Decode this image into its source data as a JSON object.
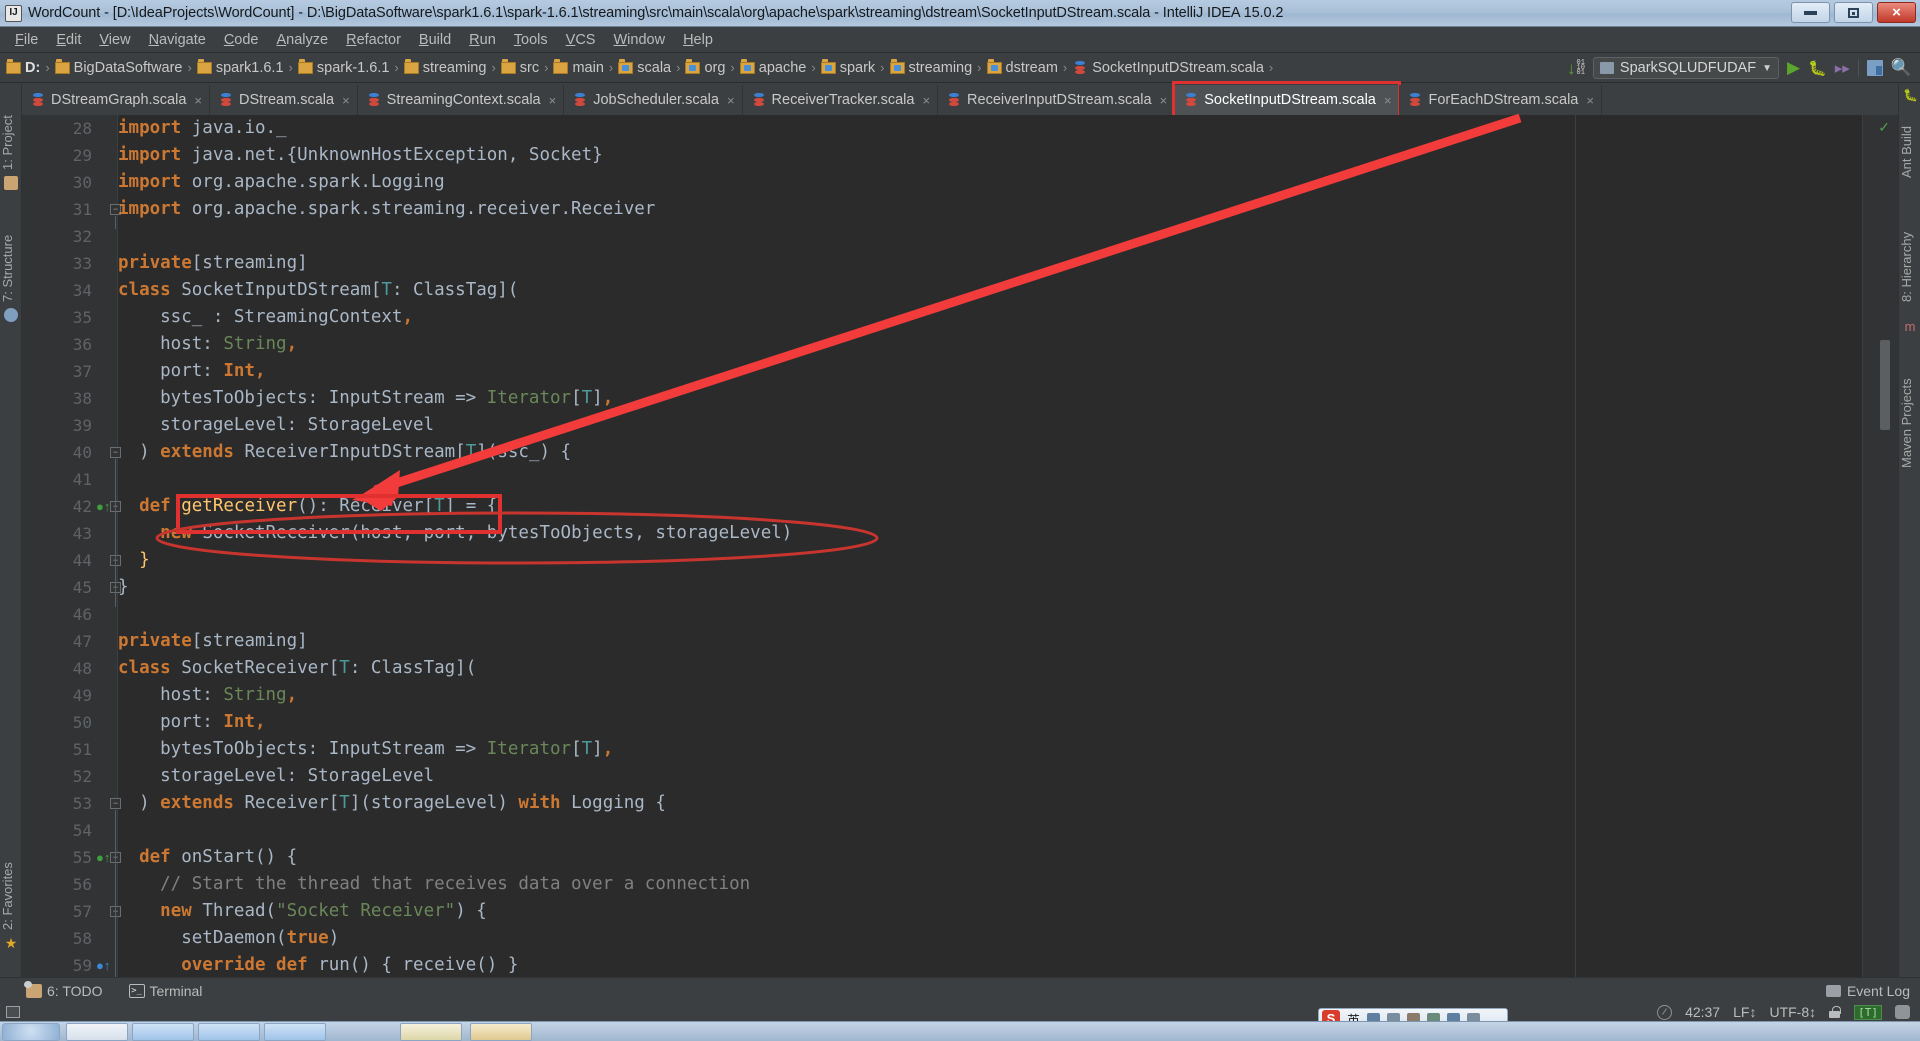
{
  "window": {
    "title": "WordCount - [D:\\IdeaProjects\\WordCount] - D:\\BigDataSoftware\\spark1.6.1\\spark-1.6.1\\streaming\\src\\main\\scala\\org\\apache\\spark\\streaming\\dstream\\SocketInputDStream.scala - IntelliJ IDEA 15.0.2",
    "app_icon": "intellij-idea-icon",
    "minimize": "minimize-button",
    "maximize": "maximize-button",
    "close": "close-button"
  },
  "menubar": {
    "items": [
      {
        "label": "File"
      },
      {
        "label": "Edit"
      },
      {
        "label": "View"
      },
      {
        "label": "Navigate"
      },
      {
        "label": "Code"
      },
      {
        "label": "Analyze"
      },
      {
        "label": "Refactor"
      },
      {
        "label": "Build"
      },
      {
        "label": "Run"
      },
      {
        "label": "Tools"
      },
      {
        "label": "VCS"
      },
      {
        "label": "Window"
      },
      {
        "label": "Help"
      }
    ]
  },
  "navbar": {
    "crumbs": [
      {
        "label": "D:",
        "icon": "folder-icon",
        "bold": true
      },
      {
        "label": "BigDataSoftware",
        "icon": "folder-icon"
      },
      {
        "label": "spark1.6.1",
        "icon": "folder-icon"
      },
      {
        "label": "spark-1.6.1",
        "icon": "folder-icon"
      },
      {
        "label": "streaming",
        "icon": "folder-icon"
      },
      {
        "label": "src",
        "icon": "folder-icon"
      },
      {
        "label": "main",
        "icon": "folder-icon"
      },
      {
        "label": "scala",
        "icon": "source-folder-icon"
      },
      {
        "label": "org",
        "icon": "package-folder-icon"
      },
      {
        "label": "apache",
        "icon": "package-folder-icon"
      },
      {
        "label": "spark",
        "icon": "package-folder-icon"
      },
      {
        "label": "streaming",
        "icon": "package-folder-icon"
      },
      {
        "label": "dstream",
        "icon": "package-folder-icon"
      },
      {
        "label": "SocketInputDStream.scala",
        "icon": "scala-file-icon"
      }
    ],
    "separator": "›",
    "run_config": "SparkSQLUDFUDAF",
    "actions": [
      {
        "name": "update-project-icon"
      },
      {
        "name": "run-button"
      },
      {
        "name": "debug-button"
      },
      {
        "name": "run-with-coverage-button"
      },
      {
        "name": "project-structure-button"
      },
      {
        "name": "search-everywhere-button"
      }
    ]
  },
  "tabs": {
    "items": [
      {
        "label": "DStreamGraph.scala",
        "active": false
      },
      {
        "label": "DStream.scala",
        "active": false
      },
      {
        "label": "StreamingContext.scala",
        "active": false
      },
      {
        "label": "JobScheduler.scala",
        "active": false
      },
      {
        "label": "ReceiverTracker.scala",
        "active": false
      },
      {
        "label": "ReceiverInputDStream.scala",
        "active": false
      },
      {
        "label": "SocketInputDStream.scala",
        "active": true
      },
      {
        "label": "ForEachDStream.scala",
        "active": false
      }
    ],
    "close_glyph": "×",
    "file_icon": "scala-file-icon"
  },
  "left_strip": {
    "items": [
      {
        "label": "1: Project",
        "icon": "project-icon"
      },
      {
        "label": "7: Structure",
        "icon": "structure-icon"
      },
      {
        "label": "2: Favorites",
        "icon": "star-icon"
      }
    ]
  },
  "right_strip": {
    "items": [
      {
        "label": "Ant Build",
        "icon": "ant-icon"
      },
      {
        "label": "8: Hierarchy",
        "icon": "hierarchy-icon"
      },
      {
        "label": "Maven Projects",
        "icon": "maven-icon"
      }
    ]
  },
  "editor": {
    "first_line": 28,
    "lines": [
      {
        "n": 28,
        "mark": "",
        "fold": "",
        "tokens": [
          {
            "t": "import ",
            "c": "kw"
          },
          {
            "t": "java.io._",
            "c": "pln"
          }
        ]
      },
      {
        "n": 29,
        "mark": "",
        "fold": "",
        "tokens": [
          {
            "t": "import ",
            "c": "kw"
          },
          {
            "t": "java.net.{UnknownHostException, Socket}",
            "c": "pln"
          }
        ]
      },
      {
        "n": 30,
        "mark": "",
        "fold": "",
        "tokens": [
          {
            "t": "import ",
            "c": "kw"
          },
          {
            "t": "org.apache.spark.Logging",
            "c": "pln"
          }
        ]
      },
      {
        "n": 31,
        "mark": "",
        "fold": "minus",
        "tokens": [
          {
            "t": "import ",
            "c": "kw"
          },
          {
            "t": "org.apache.spark.streaming.receiver.Receiver",
            "c": "pln"
          }
        ]
      },
      {
        "n": 32,
        "mark": "",
        "fold": "",
        "tokens": []
      },
      {
        "n": 33,
        "mark": "",
        "fold": "",
        "tokens": [
          {
            "t": "private",
            "c": "kw"
          },
          {
            "t": "[streaming]",
            "c": "pln"
          }
        ]
      },
      {
        "n": 34,
        "mark": "",
        "fold": "",
        "tokens": [
          {
            "t": "class ",
            "c": "kw"
          },
          {
            "t": "SocketInputDStream[",
            "c": "pln"
          },
          {
            "t": "T",
            "c": "typ"
          },
          {
            "t": ": ClassTag](",
            "c": "pln"
          }
        ]
      },
      {
        "n": 35,
        "mark": "",
        "fold": "",
        "tokens": [
          {
            "t": "    ssc_ : StreamingContext",
            "c": "pln"
          },
          {
            "t": ",",
            "c": "kw"
          }
        ]
      },
      {
        "n": 36,
        "mark": "",
        "fold": "",
        "tokens": [
          {
            "t": "    host: ",
            "c": "pln"
          },
          {
            "t": "String",
            "c": "typ2"
          },
          {
            "t": ",",
            "c": "kw"
          }
        ]
      },
      {
        "n": 37,
        "mark": "",
        "fold": "",
        "tokens": [
          {
            "t": "    port: ",
            "c": "pln"
          },
          {
            "t": "Int",
            "c": "kw"
          },
          {
            "t": ",",
            "c": "kw"
          }
        ]
      },
      {
        "n": 38,
        "mark": "",
        "fold": "",
        "tokens": [
          {
            "t": "    bytesToObjects: InputStream => ",
            "c": "pln"
          },
          {
            "t": "Iterator",
            "c": "typ2"
          },
          {
            "t": "[",
            "c": "pln"
          },
          {
            "t": "T",
            "c": "typ"
          },
          {
            "t": "]",
            "c": "pln"
          },
          {
            "t": ",",
            "c": "kw"
          }
        ]
      },
      {
        "n": 39,
        "mark": "",
        "fold": "",
        "tokens": [
          {
            "t": "    storageLevel: StorageLevel",
            "c": "pln"
          }
        ]
      },
      {
        "n": 40,
        "mark": "",
        "fold": "minus",
        "tokens": [
          {
            "t": "  ) ",
            "c": "pln"
          },
          {
            "t": "extends ",
            "c": "kw"
          },
          {
            "t": "ReceiverInputDStream[",
            "c": "pln"
          },
          {
            "t": "T",
            "c": "typ"
          },
          {
            "t": "](ssc_) {",
            "c": "pln"
          }
        ]
      },
      {
        "n": 41,
        "mark": "",
        "fold": "",
        "tokens": []
      },
      {
        "n": 42,
        "mark": "green",
        "fold": "minus",
        "tokens": [
          {
            "t": "  ",
            "c": "pln"
          },
          {
            "t": "def ",
            "c": "kw"
          },
          {
            "t": "getReceiver",
            "c": "fn"
          },
          {
            "t": "(): Receiver[",
            "c": "pln"
          },
          {
            "t": "T",
            "c": "typ"
          },
          {
            "t": "] = {",
            "c": "pln"
          }
        ]
      },
      {
        "n": 43,
        "mark": "",
        "fold": "",
        "tokens": [
          {
            "t": "    ",
            "c": "pln"
          },
          {
            "t": "new ",
            "c": "kw"
          },
          {
            "t": "SocketReceiver(host, port, bytesToObjects, storageLevel)",
            "c": "pln"
          }
        ]
      },
      {
        "n": 44,
        "mark": "",
        "fold": "plus",
        "tokens": [
          {
            "t": "  }",
            "c": "yel"
          }
        ]
      },
      {
        "n": 45,
        "mark": "",
        "fold": "plus",
        "tokens": [
          {
            "t": "}",
            "c": "pln"
          }
        ]
      },
      {
        "n": 46,
        "mark": "",
        "fold": "",
        "tokens": []
      },
      {
        "n": 47,
        "mark": "",
        "fold": "",
        "tokens": [
          {
            "t": "private",
            "c": "kw"
          },
          {
            "t": "[streaming]",
            "c": "pln"
          }
        ]
      },
      {
        "n": 48,
        "mark": "",
        "fold": "",
        "tokens": [
          {
            "t": "class ",
            "c": "kw"
          },
          {
            "t": "SocketReceiver[",
            "c": "pln"
          },
          {
            "t": "T",
            "c": "typ"
          },
          {
            "t": ": ClassTag](",
            "c": "pln"
          }
        ]
      },
      {
        "n": 49,
        "mark": "",
        "fold": "",
        "tokens": [
          {
            "t": "    host: ",
            "c": "pln"
          },
          {
            "t": "String",
            "c": "typ2"
          },
          {
            "t": ",",
            "c": "kw"
          }
        ]
      },
      {
        "n": 50,
        "mark": "",
        "fold": "",
        "tokens": [
          {
            "t": "    port: ",
            "c": "pln"
          },
          {
            "t": "Int",
            "c": "kw"
          },
          {
            "t": ",",
            "c": "kw"
          }
        ]
      },
      {
        "n": 51,
        "mark": "",
        "fold": "",
        "tokens": [
          {
            "t": "    bytesToObjects: InputStream => ",
            "c": "pln"
          },
          {
            "t": "Iterator",
            "c": "typ2"
          },
          {
            "t": "[",
            "c": "pln"
          },
          {
            "t": "T",
            "c": "typ"
          },
          {
            "t": "]",
            "c": "pln"
          },
          {
            "t": ",",
            "c": "kw"
          }
        ]
      },
      {
        "n": 52,
        "mark": "",
        "fold": "",
        "tokens": [
          {
            "t": "    storageLevel: StorageLevel",
            "c": "pln"
          }
        ]
      },
      {
        "n": 53,
        "mark": "",
        "fold": "minus",
        "tokens": [
          {
            "t": "  ) ",
            "c": "pln"
          },
          {
            "t": "extends ",
            "c": "kw"
          },
          {
            "t": "Receiver[",
            "c": "pln"
          },
          {
            "t": "T",
            "c": "typ"
          },
          {
            "t": "](storageLevel) ",
            "c": "pln"
          },
          {
            "t": "with ",
            "c": "kw"
          },
          {
            "t": "Logging {",
            "c": "pln"
          }
        ]
      },
      {
        "n": 54,
        "mark": "",
        "fold": "",
        "tokens": []
      },
      {
        "n": 55,
        "mark": "green",
        "fold": "minus",
        "tokens": [
          {
            "t": "  ",
            "c": "pln"
          },
          {
            "t": "def ",
            "c": "kw"
          },
          {
            "t": "onStart() {",
            "c": "pln"
          }
        ]
      },
      {
        "n": 56,
        "mark": "",
        "fold": "",
        "tokens": [
          {
            "t": "    // Start the thread that receives data over a connection",
            "c": "cmt"
          }
        ]
      },
      {
        "n": 57,
        "mark": "",
        "fold": "minus",
        "tokens": [
          {
            "t": "    ",
            "c": "pln"
          },
          {
            "t": "new ",
            "c": "kw"
          },
          {
            "t": "Thread(",
            "c": "pln"
          },
          {
            "t": "\"Socket Receiver\"",
            "c": "str"
          },
          {
            "t": ") {",
            "c": "pln"
          }
        ]
      },
      {
        "n": 58,
        "mark": "",
        "fold": "",
        "tokens": [
          {
            "t": "      setDaemon(",
            "c": "pln"
          },
          {
            "t": "true",
            "c": "kw"
          },
          {
            "t": ")",
            "c": "pln"
          }
        ]
      },
      {
        "n": 59,
        "mark": "blue",
        "fold": "",
        "tokens": [
          {
            "t": "      ",
            "c": "pln"
          },
          {
            "t": "override def ",
            "c": "kw"
          },
          {
            "t": "run() { receive() }",
            "c": "pln"
          }
        ]
      }
    ],
    "inspection_status": "no-errors-check-icon"
  },
  "annotations": {
    "tab_highlight_color": "#e03030",
    "arrow_color": "#f23b3b",
    "box_label": "getReceiver(): Receiver[T]",
    "ellipse_label": "new SocketReceiver(host, port, bytesToObjects, storageLevel)"
  },
  "bottombar": {
    "todo": "6: TODO",
    "terminal": "Terminal",
    "event_log": "Event Log"
  },
  "statusbar": {
    "caret": "42:37",
    "line_separator": "LF↕",
    "encoding": "UTF-8↕",
    "lock": "read-write-lock-icon",
    "translate_badge": "[T]",
    "face": "face-icon"
  },
  "taskbar": {
    "ime": {
      "mode": "英",
      "s_logo": "S",
      "icons": [
        "moon-icon",
        "quote-icon",
        "keyboard-icon",
        "tools-icon",
        "bag-icon",
        "pen-icon"
      ]
    }
  }
}
